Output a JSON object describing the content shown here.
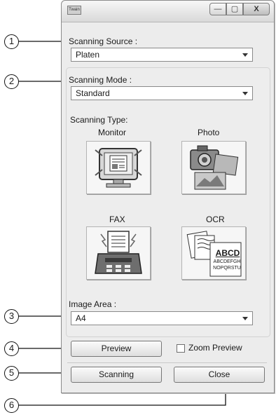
{
  "window": {
    "icon_text": "Twain",
    "controls": [
      "—",
      "▢",
      "X"
    ]
  },
  "source": {
    "label": "Scanning Source :",
    "value": "Platen"
  },
  "mode": {
    "label": "Scanning Mode :",
    "value": "Standard"
  },
  "scan_type": {
    "label": "Scanning Type:",
    "options": [
      "Monitor",
      "Photo",
      "FAX",
      "OCR"
    ],
    "ocr_sample": [
      "ABCD",
      "ABCDEFGH",
      "NOPQRSTU"
    ]
  },
  "area": {
    "label": "Image Area :",
    "value": "A4"
  },
  "buttons": {
    "preview": "Preview",
    "zoom_preview": "Zoom Preview",
    "scanning": "Scanning",
    "close": "Close"
  },
  "callouts": [
    "1",
    "2",
    "3",
    "4",
    "5",
    "6"
  ]
}
